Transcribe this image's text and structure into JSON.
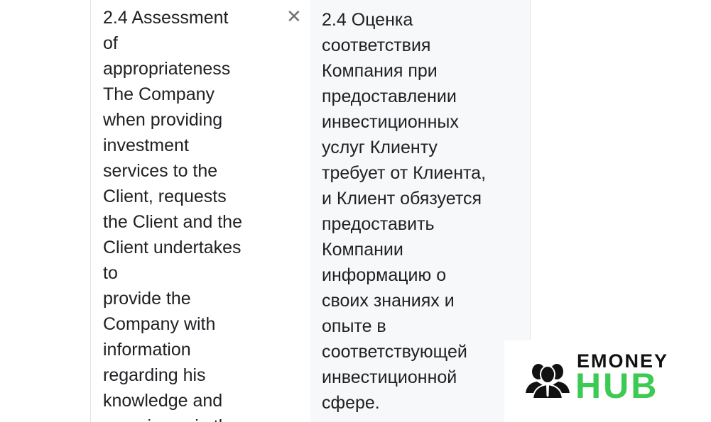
{
  "source_panel": {
    "lines": [
      "2.4 Assessment",
      "of",
      "appropriateness",
      "The Company",
      "when providing",
      "investment",
      "services to the",
      "Client, requests",
      "the Client and the",
      "Client undertakes",
      "to",
      "provide the",
      "Company with",
      "information",
      "regarding his",
      "knowledge and",
      "experience in the"
    ],
    "close_icon": "close-x-icon"
  },
  "target_panel": {
    "lines": [
      "2.4 Оценка",
      "соответствия",
      "Компания при",
      "предоставлении",
      "инвестиционных",
      "услуг Клиенту",
      "требует от Клиента,",
      "и Клиент обязуется",
      "предоставить",
      "Компании",
      "информацию о",
      "своих знаниях и",
      "опыте в",
      "соответствующей",
      "инвестиционной",
      "сфере."
    ]
  },
  "watermark": {
    "line1": "EMONEY",
    "line2": "HUB",
    "accent": "#3ccb52",
    "icon": "business-people-icon"
  }
}
